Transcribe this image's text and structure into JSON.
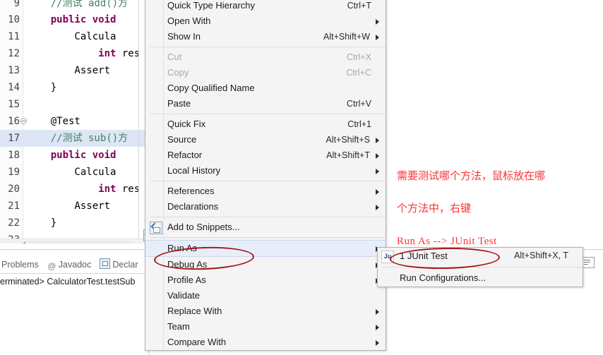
{
  "editor": {
    "lines": [
      {
        "num": "9",
        "fold": false,
        "segments": [
          {
            "t": "    //测试 add()方",
            "c": "cmt"
          }
        ],
        "highlight": false,
        "clipped_top": true
      },
      {
        "num": "10",
        "fold": false,
        "segments": [
          {
            "t": "    ",
            "c": "plain"
          },
          {
            "t": "public void",
            "c": "kw"
          }
        ],
        "highlight": false
      },
      {
        "num": "11",
        "fold": false,
        "segments": [
          {
            "t": "        Calcula",
            "c": "plain"
          }
        ],
        "highlight": false
      },
      {
        "num": "12",
        "fold": false,
        "segments": [
          {
            "t": "            ",
            "c": "plain"
          },
          {
            "t": "int",
            "c": "kw"
          },
          {
            "t": " res",
            "c": "plain"
          }
        ],
        "highlight": false
      },
      {
        "num": "13",
        "fold": false,
        "segments": [
          {
            "t": "        Assert",
            "c": "plain"
          }
        ],
        "highlight": false
      },
      {
        "num": "14",
        "fold": false,
        "segments": [
          {
            "t": "    }",
            "c": "plain"
          }
        ],
        "highlight": false
      },
      {
        "num": "15",
        "fold": false,
        "segments": [
          {
            "t": "",
            "c": "plain"
          }
        ],
        "highlight": false
      },
      {
        "num": "16",
        "fold": true,
        "segments": [
          {
            "t": "    @Test",
            "c": "plain"
          }
        ],
        "highlight": false
      },
      {
        "num": "17",
        "fold": false,
        "segments": [
          {
            "t": "    //测试 sub()方",
            "c": "cmt"
          }
        ],
        "highlight": true
      },
      {
        "num": "18",
        "fold": false,
        "segments": [
          {
            "t": "    ",
            "c": "plain"
          },
          {
            "t": "public void",
            "c": "kw"
          }
        ],
        "highlight": false
      },
      {
        "num": "19",
        "fold": false,
        "segments": [
          {
            "t": "        Calcula",
            "c": "plain"
          }
        ],
        "highlight": false
      },
      {
        "num": "20",
        "fold": false,
        "segments": [
          {
            "t": "            ",
            "c": "plain"
          },
          {
            "t": "int",
            "c": "kw"
          },
          {
            "t": " res",
            "c": "plain"
          }
        ],
        "highlight": false
      },
      {
        "num": "21",
        "fold": false,
        "segments": [
          {
            "t": "        Assert",
            "c": "plain"
          }
        ],
        "highlight": false
      },
      {
        "num": "22",
        "fold": false,
        "segments": [
          {
            "t": "    }",
            "c": "plain"
          }
        ],
        "highlight": false
      },
      {
        "num": "23",
        "fold": false,
        "segments": [
          {
            "t": "",
            "c": "plain"
          }
        ],
        "highlight": false
      }
    ]
  },
  "context_menu": {
    "items": [
      {
        "label": "Quick Type Hierarchy",
        "accel": "Ctrl+T",
        "arrow": false,
        "disabled": false,
        "type": "item"
      },
      {
        "label": "Open With",
        "accel": "",
        "arrow": true,
        "disabled": false,
        "type": "item"
      },
      {
        "label": "Show In",
        "accel": "Alt+Shift+W",
        "arrow": true,
        "disabled": false,
        "type": "item"
      },
      {
        "type": "separator"
      },
      {
        "label": "Cut",
        "accel": "Ctrl+X",
        "arrow": false,
        "disabled": true,
        "type": "item"
      },
      {
        "label": "Copy",
        "accel": "Ctrl+C",
        "arrow": false,
        "disabled": true,
        "type": "item"
      },
      {
        "label": "Copy Qualified Name",
        "accel": "",
        "arrow": false,
        "disabled": false,
        "type": "item"
      },
      {
        "label": "Paste",
        "accel": "Ctrl+V",
        "arrow": false,
        "disabled": false,
        "type": "item"
      },
      {
        "type": "separator"
      },
      {
        "label": "Quick Fix",
        "accel": "Ctrl+1",
        "arrow": false,
        "disabled": false,
        "type": "item"
      },
      {
        "label": "Source",
        "accel": "Alt+Shift+S",
        "arrow": true,
        "disabled": false,
        "type": "item"
      },
      {
        "label": "Refactor",
        "accel": "Alt+Shift+T",
        "arrow": true,
        "disabled": false,
        "type": "item"
      },
      {
        "label": "Local History",
        "accel": "",
        "arrow": true,
        "disabled": false,
        "type": "item"
      },
      {
        "type": "separator"
      },
      {
        "label": "References",
        "accel": "",
        "arrow": true,
        "disabled": false,
        "type": "item"
      },
      {
        "label": "Declarations",
        "accel": "",
        "arrow": true,
        "disabled": false,
        "type": "item"
      },
      {
        "type": "separator"
      },
      {
        "label": "Add to Snippets...",
        "accel": "",
        "arrow": false,
        "disabled": false,
        "type": "item",
        "icon": "snippet-icon"
      },
      {
        "type": "separator"
      },
      {
        "label": "Run As",
        "accel": "",
        "arrow": true,
        "disabled": false,
        "type": "item",
        "selected": true
      },
      {
        "label": "Debug As",
        "accel": "",
        "arrow": true,
        "disabled": false,
        "type": "item"
      },
      {
        "label": "Profile As",
        "accel": "",
        "arrow": true,
        "disabled": false,
        "type": "item"
      },
      {
        "label": "Validate",
        "accel": "",
        "arrow": false,
        "disabled": false,
        "type": "item"
      },
      {
        "label": "Replace With",
        "accel": "",
        "arrow": true,
        "disabled": false,
        "type": "item"
      },
      {
        "label": "Team",
        "accel": "",
        "arrow": true,
        "disabled": false,
        "type": "item"
      },
      {
        "label": "Compare With",
        "accel": "",
        "arrow": true,
        "disabled": false,
        "type": "item"
      }
    ]
  },
  "submenu": {
    "items": [
      {
        "label": "1 JUnit Test",
        "accel": "Alt+Shift+X, T",
        "icon": "junit-icon",
        "icon_text": "Ju"
      },
      {
        "type": "separator"
      },
      {
        "label": "Run Configurations...",
        "accel": "",
        "icon": ""
      }
    ]
  },
  "annotation": {
    "line1": "需要测试哪个方法，鼠标放在哪",
    "line2": "个方法中，右键",
    "line3": "Run As --> JUnit Test",
    "color": "#ff3333"
  },
  "bottom_panel": {
    "tabs": [
      {
        "label": "Problems",
        "icon": ""
      },
      {
        "label": "Javadoc",
        "icon": "at-icon"
      },
      {
        "label": "Declar",
        "icon": "declaration-icon"
      }
    ],
    "console_text": "erminated> CalculatorTest.testSub",
    "right_icons": [
      {
        "name": "run-console-icon"
      },
      {
        "name": "display-selected-console-icon"
      }
    ]
  }
}
